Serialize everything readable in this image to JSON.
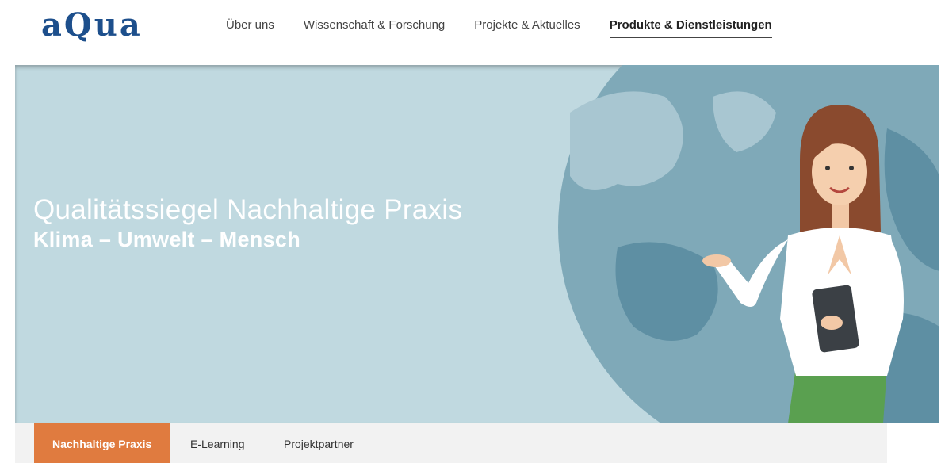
{
  "header": {
    "logo": "aQua",
    "nav": [
      {
        "label": "Über uns"
      },
      {
        "label": "Wissenschaft & Forschung"
      },
      {
        "label": "Projekte & Aktuelles"
      },
      {
        "label": "Produkte & Dienstleistungen",
        "active": true
      }
    ]
  },
  "hero": {
    "title": "Qualitätssiegel Nachhaltige Praxis",
    "subtitle": "Klima – Umwelt – Mensch",
    "illustration": "woman-presenter-with-tablet-and-globe"
  },
  "subnav": {
    "items": [
      {
        "label": "Nachhaltige Praxis",
        "active": true
      },
      {
        "label": "E-Learning"
      },
      {
        "label": "Projektpartner"
      }
    ]
  },
  "colors": {
    "brand": "#1d4f8c",
    "accent": "#e07b3f",
    "hero_bg": "#c0d9e0"
  }
}
